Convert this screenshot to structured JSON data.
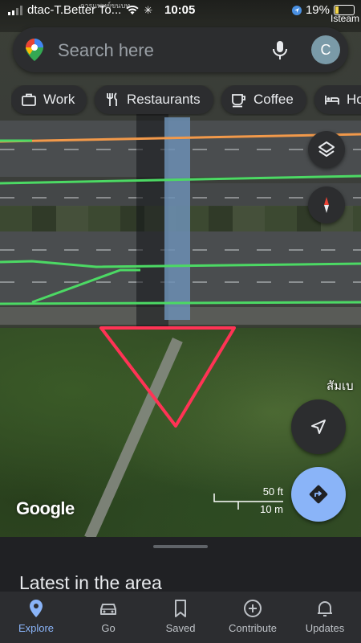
{
  "status_bar": {
    "carrier": "dtac-T.Better To...",
    "time": "10:05",
    "battery": "19%",
    "overlay_app": "Isteam",
    "tiny_thai": "การแพทย์ขนบท"
  },
  "search": {
    "placeholder": "Search here",
    "avatar_letter": "C",
    "mic_icon": "microphone-icon",
    "logo_icon": "google-maps-pin-icon"
  },
  "chips": [
    {
      "label": "Work",
      "icon": "briefcase-icon"
    },
    {
      "label": "Restaurants",
      "icon": "fork-knife-icon"
    },
    {
      "label": "Coffee",
      "icon": "coffee-cup-icon"
    },
    {
      "label": "Ho",
      "icon": "bed-icon"
    }
  ],
  "map": {
    "place_label": "สัมเบ",
    "attribution": "Google",
    "scale_ft": "50 ft",
    "scale_m": "10 m",
    "layers_icon": "layers-icon",
    "compass_icon": "compass-icon",
    "locate_icon": "navigation-arrow-icon",
    "directions_icon": "directions-icon",
    "annotation_color": "#ff3355",
    "traffic_colors": {
      "green": "#4cd964",
      "orange": "#f2994a"
    }
  },
  "sheet": {
    "title": "Latest in the area"
  },
  "nav": {
    "active": "Explore",
    "accent": "#8ab4f8",
    "items": [
      {
        "label": "Explore",
        "icon": "map-pin-icon"
      },
      {
        "label": "Go",
        "icon": "car-icon"
      },
      {
        "label": "Saved",
        "icon": "bookmark-icon"
      },
      {
        "label": "Contribute",
        "icon": "plus-circle-icon"
      },
      {
        "label": "Updates",
        "icon": "bell-icon"
      }
    ]
  }
}
